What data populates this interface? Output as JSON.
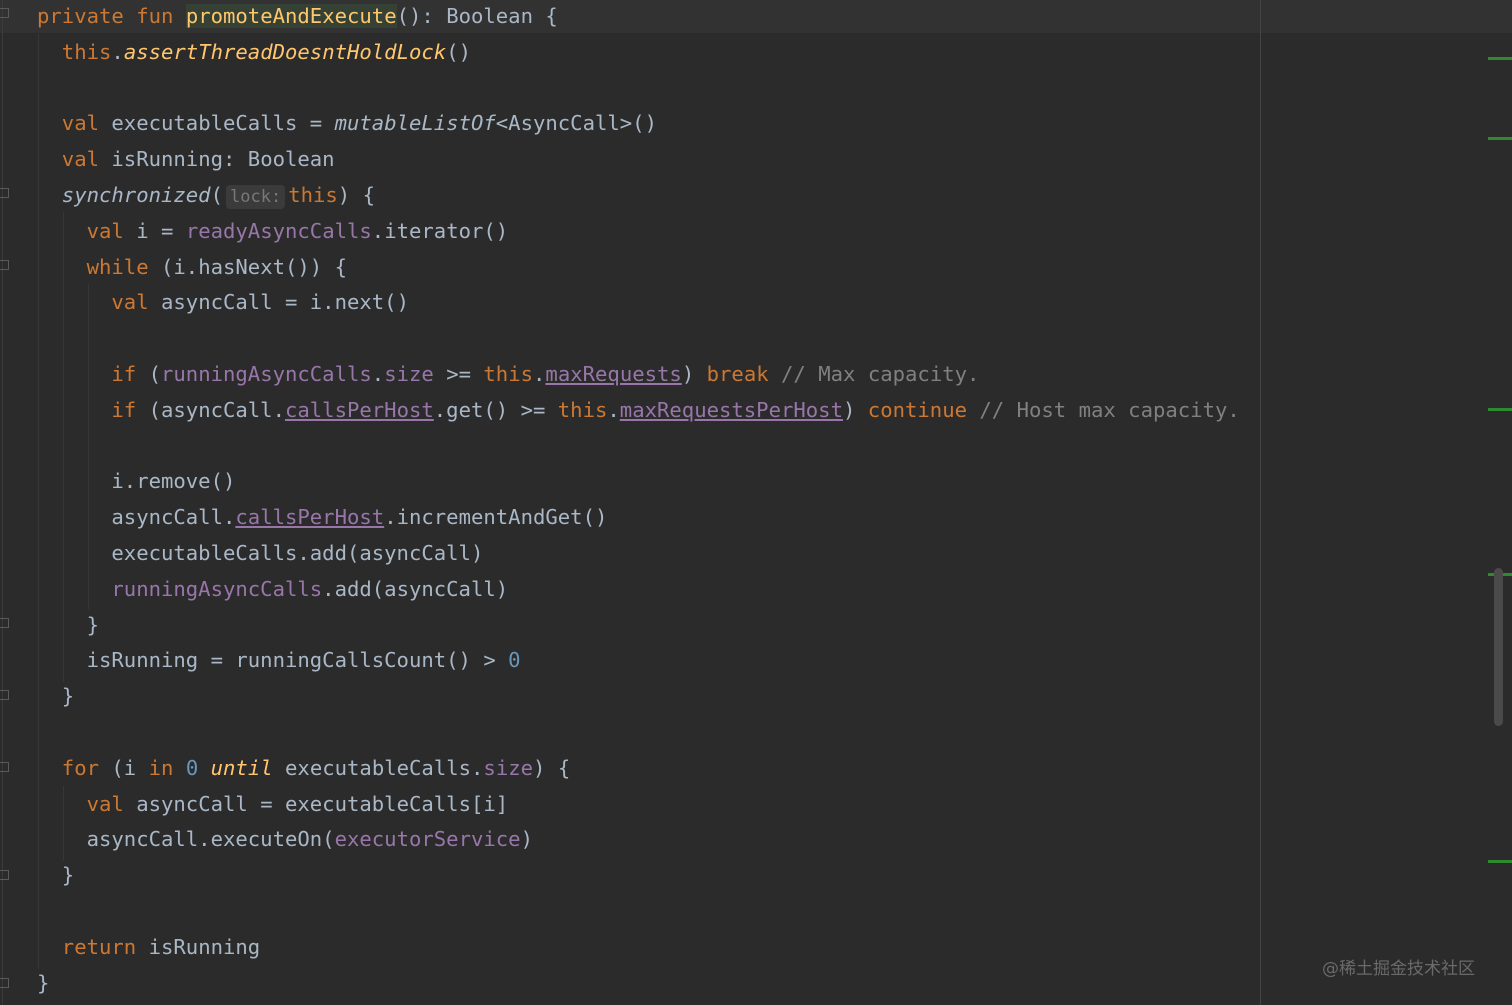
{
  "editor": {
    "indent_unit": 2,
    "lines": [
      {
        "indent": 0,
        "tokens": [
          [
            "private ",
            "kw"
          ],
          [
            "fun ",
            "kw"
          ],
          [
            "promoteAndExecute",
            "fnhl"
          ],
          [
            "(): Boolean {",
            ""
          ]
        ]
      },
      {
        "indent": 1,
        "tokens": [
          [
            "this",
            "kw"
          ],
          [
            ".",
            ""
          ],
          [
            "assertThreadDoesntHoldLock",
            "itfn"
          ],
          [
            "()",
            ""
          ]
        ]
      },
      {
        "indent": 1,
        "tokens": []
      },
      {
        "indent": 1,
        "tokens": [
          [
            "val ",
            "kw"
          ],
          [
            "executableCalls = ",
            ""
          ],
          [
            "mutableListOf",
            "it"
          ],
          [
            "<AsyncCall>()",
            ""
          ]
        ]
      },
      {
        "indent": 1,
        "tokens": [
          [
            "val ",
            "kw"
          ],
          [
            "isRunning: Boolean",
            ""
          ]
        ]
      },
      {
        "indent": 1,
        "tokens": [
          [
            "synchronized",
            "it"
          ],
          [
            "(",
            ""
          ],
          [
            "lock:",
            "hint"
          ],
          [
            "this",
            "kw"
          ],
          [
            ") {",
            ""
          ]
        ]
      },
      {
        "indent": 2,
        "tokens": [
          [
            "val ",
            "kw"
          ],
          [
            "i = ",
            ""
          ],
          [
            "readyAsyncCalls",
            "field"
          ],
          [
            ".iterator()",
            ""
          ]
        ]
      },
      {
        "indent": 2,
        "tokens": [
          [
            "while ",
            "kw"
          ],
          [
            "(i.hasNext()) {",
            ""
          ]
        ]
      },
      {
        "indent": 3,
        "tokens": [
          [
            "val ",
            "kw"
          ],
          [
            "asyncCall = i.next()",
            ""
          ]
        ]
      },
      {
        "indent": 3,
        "tokens": []
      },
      {
        "indent": 3,
        "tokens": [
          [
            "if ",
            "kw"
          ],
          [
            "(",
            ""
          ],
          [
            "runningAsyncCalls",
            "field"
          ],
          [
            ".",
            ""
          ],
          [
            "size",
            "field"
          ],
          [
            " >= ",
            ""
          ],
          [
            "this",
            "kw"
          ],
          [
            ".",
            ""
          ],
          [
            "maxRequests",
            "ulfield"
          ],
          [
            ") ",
            ""
          ],
          [
            "break ",
            "kw"
          ],
          [
            "// Max capacity.",
            "cm"
          ]
        ]
      },
      {
        "indent": 3,
        "tokens": [
          [
            "if ",
            "kw"
          ],
          [
            "(asyncCall.",
            ""
          ],
          [
            "callsPerHost",
            "ulfield"
          ],
          [
            ".get() >= ",
            ""
          ],
          [
            "this",
            "kw"
          ],
          [
            ".",
            ""
          ],
          [
            "maxRequestsPerHost",
            "ulfield"
          ],
          [
            ") ",
            ""
          ],
          [
            "continue ",
            "kw"
          ],
          [
            "// Host max capacity.",
            "cm"
          ]
        ]
      },
      {
        "indent": 3,
        "tokens": []
      },
      {
        "indent": 3,
        "tokens": [
          [
            "i.remove()",
            ""
          ]
        ]
      },
      {
        "indent": 3,
        "tokens": [
          [
            "asyncCall.",
            ""
          ],
          [
            "callsPerHost",
            "ulfield"
          ],
          [
            ".incrementAndGet()",
            ""
          ]
        ]
      },
      {
        "indent": 3,
        "tokens": [
          [
            "executableCalls.add(asyncCall)",
            ""
          ]
        ]
      },
      {
        "indent": 3,
        "tokens": [
          [
            "runningAsyncCalls",
            "field"
          ],
          [
            ".add(asyncCall)",
            ""
          ]
        ]
      },
      {
        "indent": 2,
        "tokens": [
          [
            "}",
            ""
          ]
        ]
      },
      {
        "indent": 2,
        "tokens": [
          [
            "isRunning = runningCallsCount() > ",
            ""
          ],
          [
            "0",
            "num"
          ]
        ]
      },
      {
        "indent": 1,
        "tokens": [
          [
            "}",
            ""
          ]
        ]
      },
      {
        "indent": 1,
        "tokens": []
      },
      {
        "indent": 1,
        "tokens": [
          [
            "for ",
            "kw"
          ],
          [
            "(i ",
            ""
          ],
          [
            "in ",
            "kw"
          ],
          [
            "0 ",
            "num"
          ],
          [
            "until ",
            "itfn"
          ],
          [
            "executableCalls.",
            ""
          ],
          [
            "size",
            "field"
          ],
          [
            ") {",
            ""
          ]
        ]
      },
      {
        "indent": 2,
        "tokens": [
          [
            "val ",
            "kw"
          ],
          [
            "asyncCall = executableCalls[i]",
            ""
          ]
        ]
      },
      {
        "indent": 2,
        "tokens": [
          [
            "asyncCall.executeOn(",
            ""
          ],
          [
            "executorService",
            "field"
          ],
          [
            ")",
            ""
          ]
        ]
      },
      {
        "indent": 1,
        "tokens": [
          [
            "}",
            ""
          ]
        ]
      },
      {
        "indent": 1,
        "tokens": []
      },
      {
        "indent": 1,
        "tokens": [
          [
            "return ",
            "kw"
          ],
          [
            "isRunning",
            ""
          ]
        ]
      },
      {
        "indent": 0,
        "tokens": [
          [
            "}",
            ""
          ]
        ]
      }
    ]
  },
  "watermark": "@稀土掘金技术社区",
  "colors": {
    "background": "#2b2b2b",
    "keyword": "#cc7832",
    "function": "#ffc66d",
    "field": "#9876aa",
    "number": "#6897bb",
    "comment": "#808080",
    "text": "#a9b7c6",
    "change_marker": "#2f8a2f"
  }
}
